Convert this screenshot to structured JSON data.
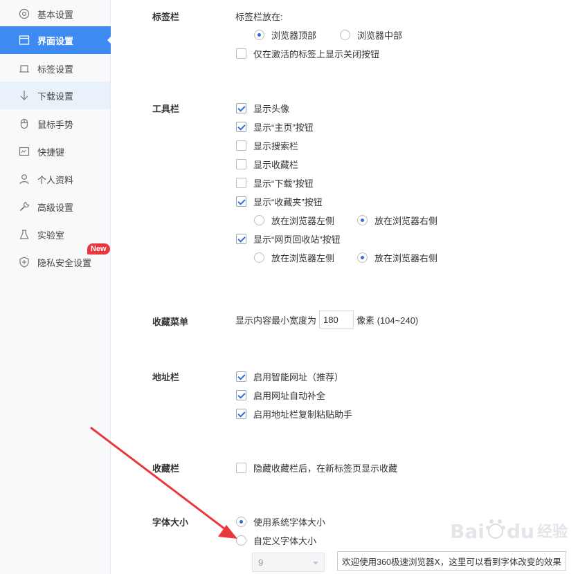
{
  "sidebar": {
    "items": [
      {
        "label": "基本设置",
        "icon": "gear-icon"
      },
      {
        "label": "界面设置",
        "icon": "window-icon"
      },
      {
        "label": "标签设置",
        "icon": "tab-icon"
      },
      {
        "label": "下载设置",
        "icon": "download-icon"
      },
      {
        "label": "鼠标手势",
        "icon": "mouse-icon"
      },
      {
        "label": "快捷键",
        "icon": "keyboard-icon"
      },
      {
        "label": "个人资料",
        "icon": "user-icon"
      },
      {
        "label": "高级设置",
        "icon": "wrench-icon"
      },
      {
        "label": "实验室",
        "icon": "flask-icon"
      },
      {
        "label": "隐私安全设置",
        "icon": "shield-icon"
      }
    ],
    "active_index": 1,
    "new_badge": "New"
  },
  "tabbar": {
    "title": "标签栏",
    "position_label": "标签栏放在:",
    "opt_top": "浏览器顶部",
    "opt_middle": "浏览器中部",
    "close_only_active": "仅在激活的标签上显示关闭按钮"
  },
  "toolbar": {
    "title": "工具栏",
    "show_avatar": "显示头像",
    "show_home": "显示“主页”按钮",
    "show_search": "显示搜索栏",
    "show_favorites": "显示收藏栏",
    "show_download": "显示“下载”按钮",
    "show_fav_folder": "显示“收藏夹”按钮",
    "left_side": "放在浏览器左侧",
    "right_side": "放在浏览器右侧",
    "show_recycle": "显示“网页回收站”按钮"
  },
  "fav_menu": {
    "title": "收藏菜单",
    "prefix": "显示内容最小宽度为",
    "value": "180",
    "suffix": "像素 (104~240)"
  },
  "address_bar": {
    "title": "地址栏",
    "smart_url": "启用智能网址（推荐）",
    "autocomplete": "启用网址自动补全",
    "paste_helper": "启用地址栏复制粘贴助手"
  },
  "fav_bar": {
    "title": "收藏栏",
    "hide_label": "隐藏收藏栏后，在新标签页显示收藏"
  },
  "font_size": {
    "title": "字体大小",
    "system": "使用系统字体大小",
    "custom": "自定义字体大小",
    "select_value": "9",
    "preview_text": "欢迎使用360极速浏览器X，这里可以看到字体改变的效果"
  },
  "watermark": {
    "text": "Bai du 经验"
  },
  "colors": {
    "accent": "#3d8bf2",
    "badge": "#e8383d",
    "arrow": "#e8383d"
  }
}
